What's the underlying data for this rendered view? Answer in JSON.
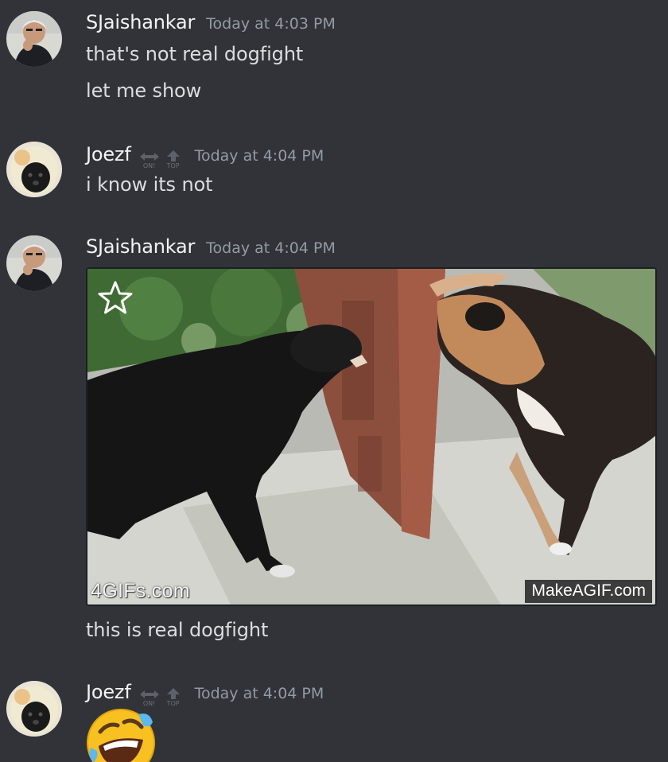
{
  "messages": [
    {
      "author": "SJaishankar",
      "timestamp": "Today at 4:03 PM",
      "lines": [
        "that's not real dogfight",
        "let me show"
      ]
    },
    {
      "author": "Joezf",
      "timestamp": "Today at 4:04 PM",
      "badges": [
        {
          "icon": "swap-arrows-icon",
          "label": "ON!"
        },
        {
          "icon": "up-arrow-icon",
          "label": "TOP"
        }
      ],
      "lines": [
        "i know its not"
      ]
    },
    {
      "author": "SJaishankar",
      "timestamp": "Today at 4:04 PM",
      "attachment": {
        "type": "gif",
        "favorite_icon": "star-icon",
        "watermark_left": "4GIFs.com",
        "watermark_right": "MakeAGIF.com"
      },
      "lines": [
        "this is real dogfight"
      ]
    },
    {
      "author": "Joezf",
      "timestamp": "Today at 4:04 PM",
      "badges": [
        {
          "icon": "swap-arrows-icon",
          "label": "ON!"
        },
        {
          "icon": "up-arrow-icon",
          "label": "TOP"
        }
      ],
      "emoji": "rolling-on-floor-laughing-emoji"
    }
  ],
  "colors": {
    "background": "#313338",
    "username": "#f2f3f5",
    "message_text": "#dbdee1",
    "timestamp": "#949ba4"
  }
}
